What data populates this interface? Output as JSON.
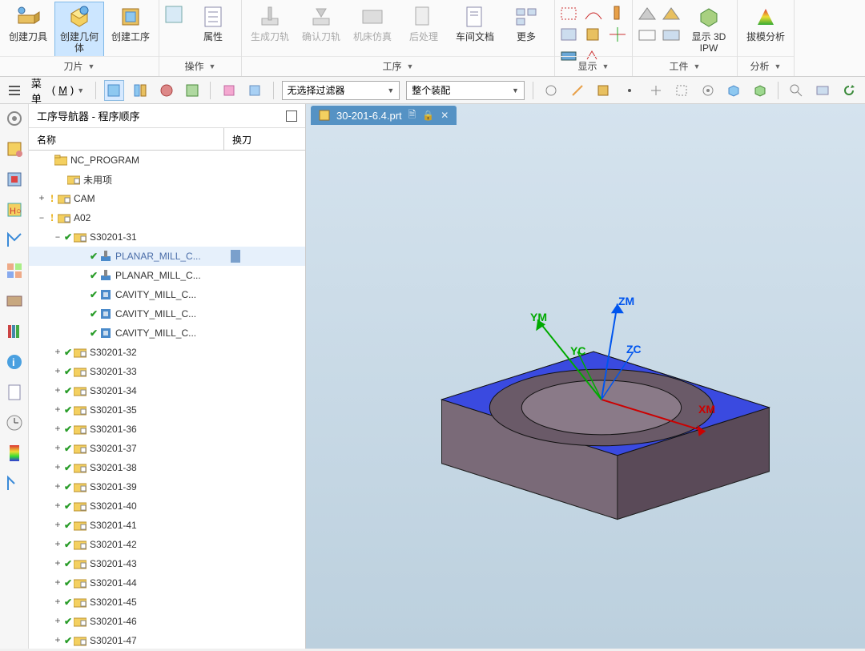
{
  "ribbon": {
    "groups": [
      {
        "label": "刀片",
        "items": [
          {
            "label": "创建刀具",
            "icon": "tool-icon"
          },
          {
            "label": "创建几何体",
            "icon": "geometry-icon",
            "active": true
          },
          {
            "label": "创建工序",
            "icon": "operation-icon"
          }
        ]
      },
      {
        "label": "操作",
        "items": [
          {
            "label": "属性",
            "icon": "properties-icon"
          }
        ]
      },
      {
        "label": "工序",
        "items": [
          {
            "label": "生成刀轨",
            "icon": "generate-toolpath-icon",
            "disabled": true
          },
          {
            "label": "确认刀轨",
            "icon": "verify-toolpath-icon",
            "disabled": true
          },
          {
            "label": "机床仿真",
            "icon": "machine-sim-icon",
            "disabled": true
          },
          {
            "label": "后处理",
            "icon": "postprocess-icon",
            "disabled": true
          },
          {
            "label": "车间文档",
            "icon": "shopfloor-doc-icon"
          },
          {
            "label": "更多",
            "icon": "more-icon"
          }
        ]
      },
      {
        "label": "显示",
        "grid": true
      },
      {
        "label": "工件",
        "items": [
          {
            "label": "显示 3D IPW",
            "icon": "ipw-icon"
          }
        ],
        "grid_extra": true
      },
      {
        "label": "分析",
        "items": [
          {
            "label": "拔模分析",
            "icon": "draft-analysis-icon"
          }
        ]
      }
    ]
  },
  "toolbar": {
    "menu_label": "菜单",
    "menu_accel": "M",
    "filter1": "无选择过滤器",
    "filter2": "整个装配"
  },
  "nav": {
    "title": "工序导航器 - 程序顺序",
    "col1": "名称",
    "col2": "换刀",
    "root": "NC_PROGRAM",
    "unused": "未用项",
    "cam": "CAM",
    "a02": "A02",
    "group_open": "S30201-31",
    "ops": [
      "PLANAR_MILL_C...",
      "PLANAR_MILL_C...",
      "CAVITY_MILL_C...",
      "CAVITY_MILL_C...",
      "CAVITY_MILL_C..."
    ],
    "groups": [
      "S30201-32",
      "S30201-33",
      "S30201-34",
      "S30201-35",
      "S30201-36",
      "S30201-37",
      "S30201-38",
      "S30201-39",
      "S30201-40",
      "S30201-41",
      "S30201-42",
      "S30201-43",
      "S30201-44",
      "S30201-45",
      "S30201-46",
      "S30201-47"
    ]
  },
  "tab": {
    "filename": "30-201-6.4.prt"
  },
  "axes": {
    "xm": "XM",
    "ym": "YM",
    "zm": "ZM",
    "yc": "YC",
    "zc": "ZC"
  }
}
